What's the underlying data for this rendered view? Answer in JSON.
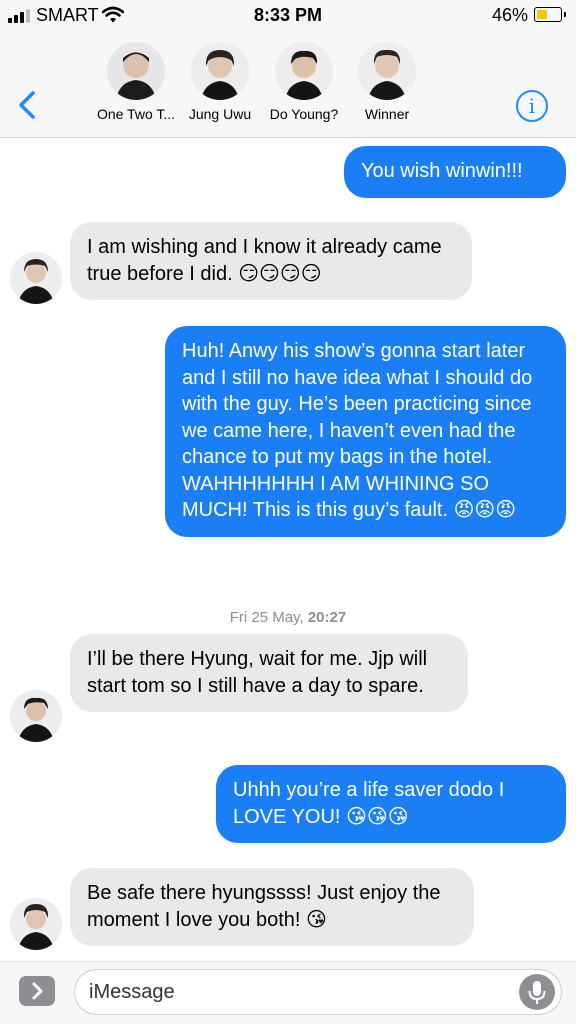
{
  "status_bar": {
    "carrier": "SMART",
    "time": "8:33 PM",
    "battery_percent": "46%",
    "battery_level": 0.46,
    "battery_color": "#f7c400"
  },
  "header": {
    "participants": [
      {
        "name": "One Two T..."
      },
      {
        "name": "Jung Uwu"
      },
      {
        "name": "Do Young?"
      },
      {
        "name": "Winner"
      }
    ],
    "back_icon": "chevron-left-icon",
    "info_icon": "info-icon",
    "info_label": "i",
    "accent_color": "#1a8cff"
  },
  "messages": {
    "m1": {
      "direction": "sent",
      "text": "You wish winwin!!!"
    },
    "m2": {
      "direction": "received",
      "text": "I am wishing and I know it already came true before I did. 😏😏😏😏"
    },
    "m3": {
      "direction": "sent",
      "text": "Huh! Anwy his show’s gonna start later and I still no have idea what I should do with the guy. He’s been practicing since we came here, I haven’t even had the chance to put my bags in the hotel. WAHHHHHHH I AM WHINING SO MUCH! This is this guy’s fault. 😡😡😡"
    },
    "timestamp_day": "Fri 25 May,",
    "timestamp_time": "20:27",
    "m4": {
      "direction": "received",
      "text": "I’ll be there Hyung, wait for me. Jjp will start tom so I still have a day to spare."
    },
    "m5": {
      "direction": "sent",
      "text": "Uhhh you’re a life saver dodo I LOVE YOU! 😘😘😘"
    },
    "m6": {
      "direction": "received",
      "text": "Be safe there hyungssss! Just enjoy the moment I love you both! 😘"
    },
    "sent_color": "#1a7ff5",
    "received_color": "#e9e9eb"
  },
  "input_bar": {
    "placeholder": "iMessage",
    "apps_icon": "app-store-chevron-icon",
    "mic_icon": "microphone-icon"
  }
}
